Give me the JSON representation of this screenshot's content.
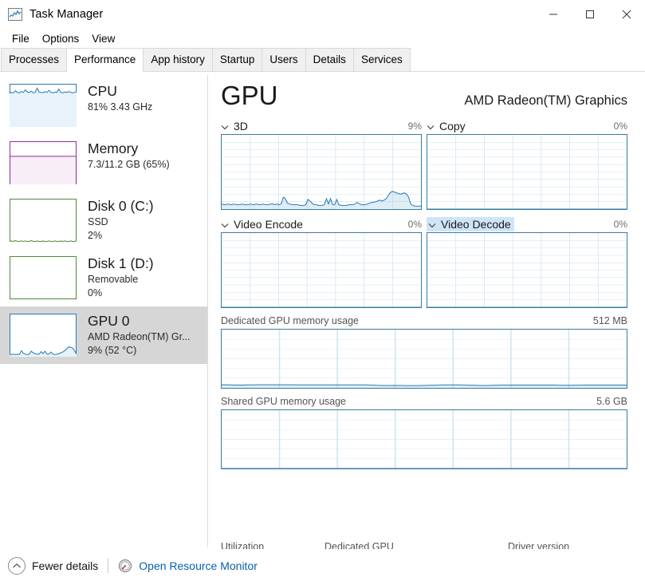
{
  "window": {
    "title": "Task Manager",
    "icon": "task-manager-icon",
    "controls": {
      "minimize": "─",
      "maximize": "☐",
      "close": "✕"
    }
  },
  "menu": {
    "items": [
      "File",
      "Options",
      "View"
    ]
  },
  "tabs": {
    "items": [
      {
        "label": "Processes",
        "selected": false
      },
      {
        "label": "Performance",
        "selected": true
      },
      {
        "label": "App history",
        "selected": false
      },
      {
        "label": "Startup",
        "selected": false
      },
      {
        "label": "Users",
        "selected": false
      },
      {
        "label": "Details",
        "selected": false
      },
      {
        "label": "Services",
        "selected": false
      }
    ]
  },
  "sidebar": {
    "items": [
      {
        "title": "CPU",
        "line1": "81%  3.43 GHz",
        "line2": "",
        "selected": false,
        "accent": "#2a7ab0",
        "fill": "#e8f2fa",
        "level": 0.81,
        "kind": "line"
      },
      {
        "title": "Memory",
        "line1": "7.3/11.2 GB (65%)",
        "line2": "",
        "selected": false,
        "accent": "#8c2f94",
        "fill": "#f7eef8",
        "level": 0.65,
        "kind": "block"
      },
      {
        "title": "Disk 0 (C:)",
        "line1": "SSD",
        "line2": "2%",
        "selected": false,
        "accent": "#4e8a3d",
        "fill": "#f2f8f0",
        "level": 0.02,
        "kind": "line"
      },
      {
        "title": "Disk 1 (D:)",
        "line1": "Removable",
        "line2": "0%",
        "selected": false,
        "accent": "#4e8a3d",
        "fill": "#f2f8f0",
        "level": 0.0,
        "kind": "line"
      },
      {
        "title": "GPU 0",
        "line1": "AMD Radeon(TM) Gr...",
        "line2": "9%  (52 °C)",
        "selected": true,
        "accent": "#2a7ab0",
        "fill": "#e8f2fa",
        "level": 0.09,
        "kind": "line"
      }
    ]
  },
  "main": {
    "title": "GPU",
    "device": "AMD Radeon(TM) Graphics",
    "engines": [
      {
        "name": "3D",
        "percent": "9%",
        "highlighted": false
      },
      {
        "name": "Copy",
        "percent": "0%",
        "highlighted": false
      },
      {
        "name": "Video Encode",
        "percent": "0%",
        "highlighted": false
      },
      {
        "name": "Video Decode",
        "percent": "0%",
        "highlighted": true
      }
    ],
    "memory": [
      {
        "label": "Dedicated GPU memory usage",
        "value": "512 MB"
      },
      {
        "label": "Shared GPU memory usage",
        "value": "5.6 GB"
      }
    ],
    "clipped_stats": [
      "Utilization",
      "Dedicated GPU",
      "Driver version"
    ]
  },
  "status": {
    "fewer_details": "Fewer details",
    "resource_monitor": "Open Resource Monitor"
  },
  "chart_data": [
    {
      "type": "line",
      "title": "3D",
      "ylabel": "%",
      "ylim": [
        0,
        100
      ],
      "grid": true,
      "grid_cols": 7,
      "grid_rows": 10,
      "values": [
        7,
        6,
        6,
        7,
        6,
        6,
        7,
        6,
        6,
        6,
        7,
        6,
        6,
        6,
        7,
        6,
        6,
        7,
        6,
        6,
        7,
        6,
        6,
        6,
        7,
        7,
        6,
        7,
        6,
        7,
        16,
        14,
        8,
        7,
        6,
        6,
        6,
        6,
        5,
        5,
        5,
        6,
        13,
        11,
        8,
        6,
        6,
        5,
        5,
        5,
        6,
        14,
        7,
        14,
        6,
        6,
        13,
        6,
        5,
        5,
        5,
        5,
        6,
        6,
        6,
        7,
        9,
        7,
        6,
        6,
        6,
        7,
        8,
        9,
        9,
        10,
        11,
        12,
        11,
        12,
        14,
        18,
        22,
        24,
        23,
        22,
        21,
        20,
        21,
        22,
        20,
        16,
        7,
        5,
        4,
        4,
        4,
        4
      ]
    },
    {
      "type": "line",
      "title": "Copy",
      "ylabel": "%",
      "ylim": [
        0,
        100
      ],
      "grid": true,
      "grid_cols": 7,
      "grid_rows": 10,
      "values": [
        0,
        0,
        0,
        0,
        0,
        0,
        0,
        0,
        0,
        0,
        0,
        0,
        0,
        0,
        0,
        0,
        0,
        0,
        0,
        0,
        0,
        0,
        0,
        0,
        0,
        0,
        0,
        0,
        0,
        0,
        0,
        0,
        0,
        0,
        0,
        0,
        0,
        0,
        0,
        0,
        0,
        0,
        0,
        0,
        0,
        0,
        0,
        0,
        0,
        0,
        0,
        0,
        0,
        0,
        0,
        0,
        0,
        0,
        0,
        0,
        0,
        0,
        0,
        0,
        0,
        0,
        0,
        0,
        0,
        0,
        0,
        0,
        0,
        0,
        0,
        0,
        0,
        0,
        0,
        0,
        0,
        0,
        0,
        0,
        0,
        0,
        0,
        0,
        0,
        0,
        0,
        0,
        0,
        0,
        0,
        0
      ]
    },
    {
      "type": "line",
      "title": "Video Encode",
      "ylabel": "%",
      "ylim": [
        0,
        100
      ],
      "grid": true,
      "grid_cols": 7,
      "grid_rows": 10,
      "values": [
        0,
        0,
        0,
        0,
        0,
        0,
        0,
        0,
        0,
        0,
        0,
        0,
        0,
        0,
        0,
        0,
        0,
        0,
        0,
        0,
        0,
        0,
        0,
        0,
        0,
        0,
        0,
        0,
        0,
        0,
        0,
        0,
        0,
        0,
        0,
        0,
        0,
        0,
        0,
        0,
        0,
        0,
        0,
        0,
        0,
        0,
        0,
        0,
        0,
        0,
        0,
        0,
        0,
        0,
        0,
        0,
        0,
        0,
        0,
        0,
        0,
        0,
        0,
        0,
        0,
        0,
        0,
        0,
        0,
        0,
        0,
        0,
        0,
        0,
        0,
        0,
        0,
        0,
        0,
        0,
        0,
        0,
        0,
        0,
        0,
        0,
        0,
        0,
        0,
        0,
        0,
        0,
        0,
        0,
        0,
        0
      ]
    },
    {
      "type": "line",
      "title": "Video Decode",
      "ylabel": "%",
      "ylim": [
        0,
        100
      ],
      "grid": true,
      "grid_cols": 7,
      "grid_rows": 10,
      "values": [
        0,
        0,
        0,
        0,
        0,
        0,
        0,
        0,
        0,
        0,
        0,
        0,
        0,
        0,
        0,
        0,
        0,
        0,
        0,
        0,
        0,
        0,
        0,
        0,
        0,
        0,
        0,
        0,
        0,
        0,
        0,
        0,
        0,
        0,
        0,
        0,
        0,
        0,
        0,
        0,
        0,
        0,
        0,
        0,
        0,
        0,
        0,
        0,
        0,
        0,
        0,
        0,
        0,
        0,
        0,
        0,
        0,
        0,
        0,
        0,
        0,
        0,
        0,
        0,
        0,
        0,
        0,
        0,
        0,
        0,
        0,
        0,
        0,
        0,
        0,
        0,
        0,
        0,
        0,
        0,
        0,
        0,
        0,
        0,
        0,
        0,
        0,
        0,
        0,
        0,
        0,
        0,
        0,
        0,
        0,
        0
      ]
    },
    {
      "type": "area",
      "title": "Dedicated GPU memory usage",
      "ylabel": "MB",
      "ylim": [
        0,
        512
      ],
      "grid": true,
      "grid_cols": 7,
      "grid_rows": 6,
      "values": [
        27,
        27,
        26,
        25,
        25,
        25,
        26,
        26,
        27,
        27,
        27,
        27,
        27,
        27,
        27,
        27,
        27,
        27,
        26,
        26,
        26,
        26,
        26,
        26,
        26,
        26,
        26,
        26,
        26,
        26,
        26,
        26,
        26,
        26,
        26,
        25,
        23,
        22,
        21,
        21,
        21,
        21,
        21,
        20,
        20,
        20,
        20,
        21,
        22,
        23,
        24,
        25,
        26,
        26,
        26,
        26,
        26,
        25,
        24,
        23,
        22,
        21,
        21,
        22,
        23,
        24,
        25,
        25,
        25,
        25,
        25,
        25,
        25,
        25,
        25,
        25,
        25,
        25,
        25,
        24,
        23,
        23,
        23,
        24,
        24,
        25,
        25,
        25,
        25,
        25,
        25,
        25,
        25,
        25,
        25,
        25
      ]
    },
    {
      "type": "area",
      "title": "Shared GPU memory usage",
      "ylabel": "GB",
      "ylim": [
        0,
        5.6
      ],
      "grid": true,
      "grid_cols": 7,
      "grid_rows": 6,
      "values": [
        0,
        0,
        0,
        0,
        0,
        0,
        0,
        0,
        0,
        0,
        0,
        0,
        0,
        0,
        0,
        0,
        0,
        0,
        0,
        0,
        0,
        0,
        0,
        0,
        0,
        0,
        0,
        0,
        0,
        0,
        0,
        0,
        0,
        0,
        0,
        0,
        0,
        0,
        0,
        0,
        0,
        0,
        0,
        0,
        0,
        0,
        0,
        0,
        0,
        0,
        0,
        0,
        0,
        0,
        0,
        0,
        0,
        0,
        0,
        0,
        0,
        0,
        0,
        0,
        0,
        0,
        0,
        0,
        0,
        0,
        0,
        0,
        0,
        0,
        0,
        0,
        0,
        0,
        0,
        0,
        0,
        0,
        0,
        0,
        0,
        0,
        0,
        0,
        0,
        0,
        0,
        0,
        0,
        0,
        0,
        0
      ]
    }
  ],
  "sidebar_charts": [
    {
      "name": "CPU",
      "values": [
        78,
        80,
        79,
        84,
        80,
        79,
        82,
        80,
        86,
        81,
        80,
        83,
        79,
        80,
        90,
        81,
        80,
        79,
        82,
        80,
        85,
        80,
        79,
        81,
        80,
        88,
        80,
        79,
        81,
        80,
        82,
        80,
        79,
        80,
        81
      ]
    },
    {
      "name": "Disk 0 (C:)",
      "values": [
        1,
        2,
        1,
        3,
        1,
        1,
        2,
        1,
        2,
        1,
        1,
        3,
        1,
        1,
        2,
        1,
        1,
        2,
        1,
        1,
        2,
        1,
        1,
        2,
        1,
        1,
        2,
        1,
        2,
        1,
        1,
        2,
        1,
        1,
        2
      ]
    },
    {
      "name": "GPU 0",
      "values": [
        5,
        5,
        6,
        5,
        6,
        5,
        14,
        8,
        6,
        5,
        6,
        13,
        9,
        7,
        6,
        6,
        12,
        7,
        13,
        6,
        6,
        11,
        6,
        5,
        6,
        7,
        9,
        11,
        14,
        19,
        23,
        22,
        20,
        14,
        6
      ]
    }
  ]
}
